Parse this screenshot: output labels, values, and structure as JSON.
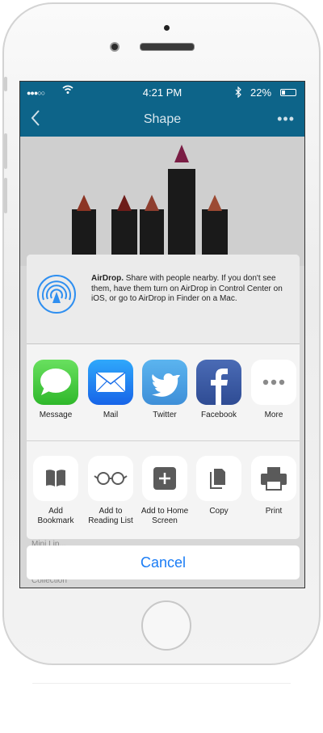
{
  "status_bar": {
    "signal": "●●●○○",
    "wifi_icon": "wifi-icon",
    "time": "4:21 PM",
    "bluetooth_icon": "bluetooth-icon",
    "battery": "22%"
  },
  "nav": {
    "title": "Shape",
    "back_icon": "chevron-left-icon",
    "more": "•••"
  },
  "airdrop": {
    "title": "AirDrop.",
    "text": " Share with people nearby. If you don't see them, have them turn on AirDrop in Control Center on iOS, or go to AirDrop in Finder on a Mac."
  },
  "share_row": [
    {
      "label": "Message"
    },
    {
      "label": "Mail"
    },
    {
      "label": "Twitter"
    },
    {
      "label": "Facebook"
    },
    {
      "label": "More"
    }
  ],
  "action_row": [
    {
      "label": "Add Bookmark"
    },
    {
      "label": "Add to Reading List"
    },
    {
      "label": "Add to Home Screen"
    },
    {
      "label": "Copy"
    },
    {
      "label": "Print"
    }
  ],
  "cancel_label": "Cancel",
  "behind": {
    "row1": "Mini Lip...",
    "row2": "Collection"
  },
  "colors": {
    "accent": "#0d6489",
    "ios_blue": "#1a7cf5"
  }
}
